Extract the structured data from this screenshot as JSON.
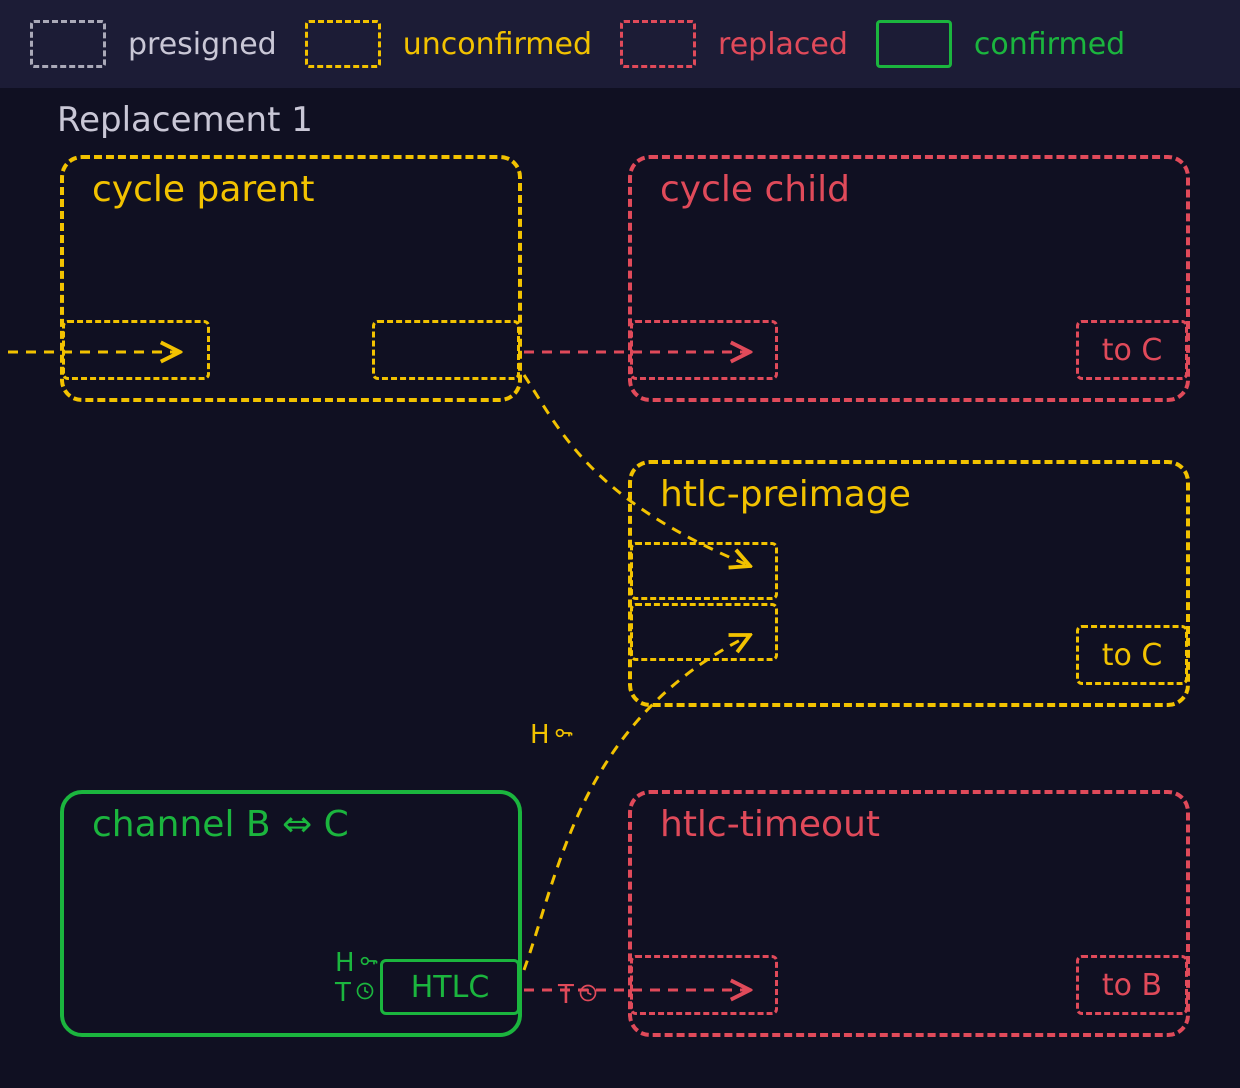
{
  "legend": {
    "presigned": "presigned",
    "unconfirmed": "unconfirmed",
    "replaced": "replaced",
    "confirmed": "confirmed"
  },
  "section_title": "Replacement 1",
  "colors": {
    "presigned": "#aaa9b8",
    "unconfirmed": "#f2c200",
    "replaced": "#e04a5a",
    "confirmed": "#1bb53e",
    "bg": "#101022",
    "bar": "#1c1c36",
    "text": "#c9c7d6"
  },
  "nodes": {
    "cycle_parent": {
      "label": "cycle parent",
      "status": "unconfirmed"
    },
    "cycle_child": {
      "label": "cycle child",
      "status": "replaced",
      "output_label": "to C"
    },
    "htlc_preimage": {
      "label": "htlc-preimage",
      "status": "unconfirmed",
      "output_label": "to C"
    },
    "channel_bc": {
      "label": "channel B ⇔ C",
      "status": "confirmed",
      "output_label": "HTLC",
      "h_label": "H",
      "t_label": "T"
    },
    "htlc_timeout": {
      "label": "htlc-timeout",
      "status": "replaced",
      "output_label": "to B"
    }
  },
  "edge_labels": {
    "h_key": "H",
    "t_clock": "T"
  }
}
